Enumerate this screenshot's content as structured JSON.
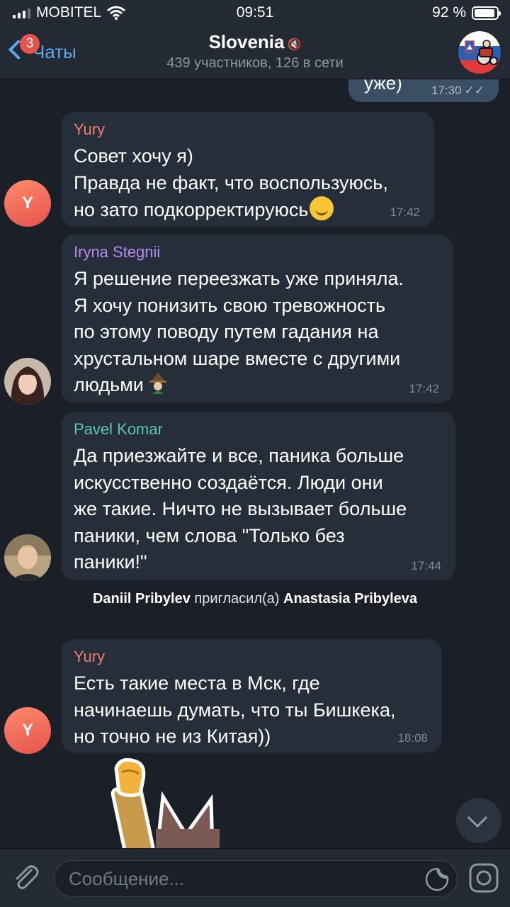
{
  "status": {
    "carrier": "MOBITEL",
    "time": "09:51",
    "battery": "92 %",
    "battery_level": 0.92
  },
  "header": {
    "back_label": "Чаты",
    "unread_badge": "3",
    "title": "Slovenia",
    "subtitle": "439 участников, 126 в сети"
  },
  "outgoing_partial": {
    "text": "уже)",
    "time": "17:30"
  },
  "messages": [
    {
      "author": "Yury",
      "author_color": "#f07d6b",
      "avatar_letter": "Y",
      "text": "Совет хочу я)\nПравда не факт, что воспользуюсь,\nно зато подкорректируюсь",
      "time": "17:42"
    },
    {
      "author": "Iryna Stegnii",
      "author_color": "#b58bf2",
      "text": "Я решение переезжать уже приняла.\nЯ хочу понизить свою тревожность\nпо этому поводу путем гадания на\nхрустальном шаре вместе с другими\nлюдьми",
      "time": "17:42"
    },
    {
      "author": "Pavel Komar",
      "author_color": "#57c5b6",
      "text": "Да приезжайте и все, паника больше\nискусственно создаётся. Люди они\nже такие. Ничто не вызывает больше\nпаники, чем слова \"Только без\nпаники!\"",
      "time": "17:44"
    },
    {
      "author": "Yury",
      "author_color": "#f07d6b",
      "avatar_letter": "Y",
      "text": "Есть такие места в Мск, где\nначинаешь думать, что ты Бишкека,\nно точно не из Китая))",
      "time": "18:08"
    }
  ],
  "service_message": {
    "actor": "Daniil Pribylev",
    "action": "пригласил(а)",
    "target": "Anastasia Pribyleva"
  },
  "input": {
    "placeholder": "Сообщение..."
  }
}
